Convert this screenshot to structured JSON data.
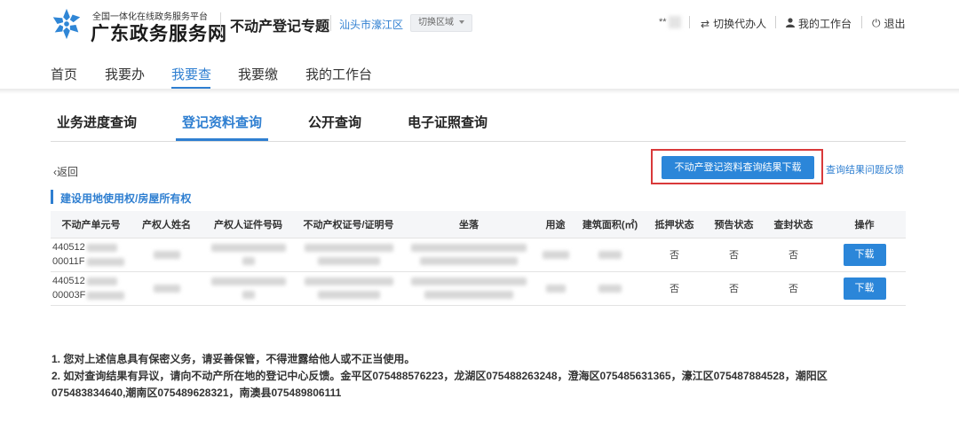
{
  "header": {
    "logo_subtitle": "全国一体化在线政务服务平台",
    "logo_title": "广东政务服务网",
    "topic": "不动产登记专题",
    "region": "汕头市濠江区",
    "switch_region": "切换区域",
    "masked_user": "**",
    "links": {
      "switch_agent": "切换代办人",
      "my_workbench": "我的工作台",
      "logout": "退出"
    }
  },
  "nav": {
    "items": [
      "首页",
      "我要办",
      "我要查",
      "我要缴",
      "我的工作台"
    ],
    "active": "我要查"
  },
  "tabs": {
    "items": [
      "业务进度查询",
      "登记资料查询",
      "公开查询",
      "电子证照查询"
    ],
    "active": "登记资料查询"
  },
  "actions": {
    "back": "返回",
    "download_result": "不动产登记资料查询结果下载",
    "feedback": "查询结果问题反馈"
  },
  "section_title": "建设用地使用权/房屋所有权",
  "table": {
    "headers": [
      "不动产单元号",
      "产权人姓名",
      "产权人证件号码",
      "不动产权证号/证明号",
      "坐落",
      "用途",
      "建筑面积(㎡)",
      "抵押状态",
      "预告状态",
      "查封状态",
      "操作"
    ],
    "rows": [
      {
        "unit_prefix_1": "440512",
        "unit_prefix_2": "00011F",
        "mortgage": "否",
        "notice": "否",
        "seal": "否",
        "action": "下载"
      },
      {
        "unit_prefix_1": "440512",
        "unit_prefix_2": "00003F",
        "mortgage": "否",
        "notice": "否",
        "seal": "否",
        "action": "下载"
      }
    ]
  },
  "notes": {
    "line1": "1. 您对上述信息具有保密义务，请妥善保管，不得泄露给他人或不正当使用。",
    "line2": "2. 如对查询结果有异议，请向不动产所在地的登记中心反馈。金平区075488576223，龙湖区075488263248，澄海区075485631365，濠江区075487884528，潮阳区",
    "line3": "075483834640,潮南区075489628321，南澳县075489806111"
  },
  "colors": {
    "accent": "#2f7fd1",
    "button": "#2b86d9",
    "highlight_box": "#d9393a"
  }
}
